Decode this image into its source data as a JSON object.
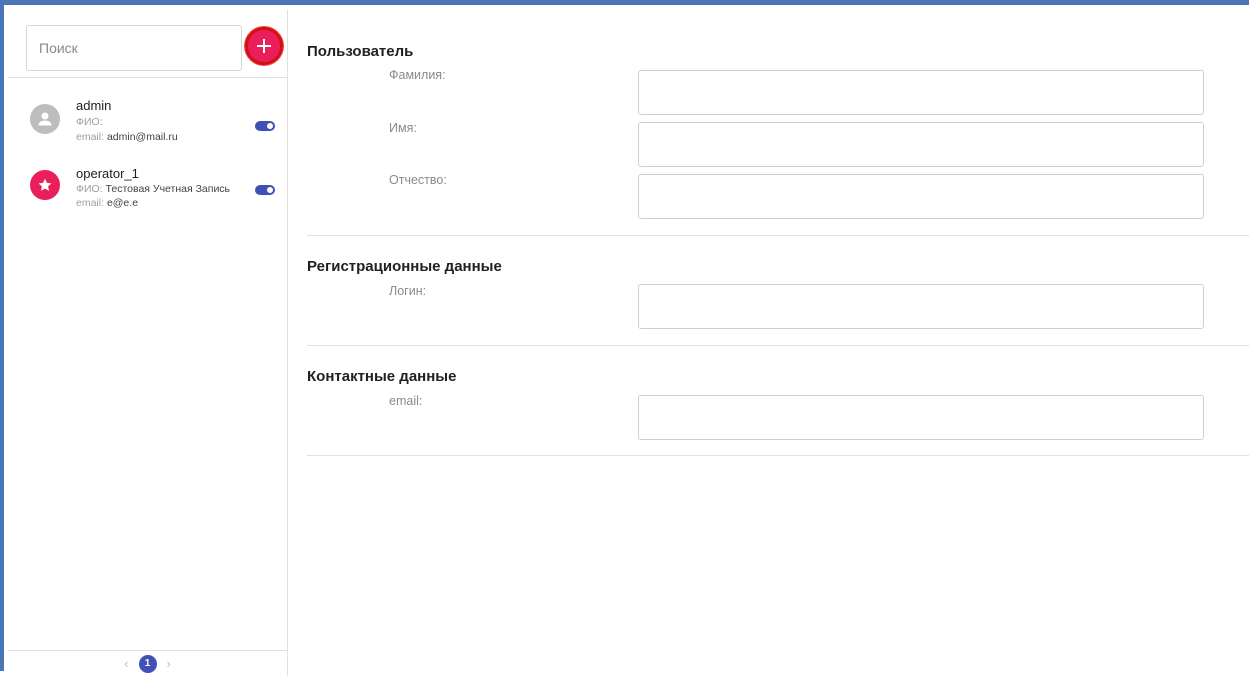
{
  "colors": {
    "frame_border": "#4a76b8",
    "accent_pink": "#e91e5a",
    "highlight_red": "#d41016",
    "toggle_blue": "#3f51b5",
    "avatar_grey": "#bdbdbd"
  },
  "sidebar": {
    "search": {
      "placeholder": "Поиск",
      "value": ""
    },
    "add_button": {
      "icon": "plus-icon"
    },
    "users": [
      {
        "name": "admin",
        "fio_label": "ФИО:",
        "fio_value": "",
        "email_label": "email:",
        "email_value": "admin@mail.ru",
        "avatar_icon": "person-icon",
        "enabled": true
      },
      {
        "name": "operator_1",
        "fio_label": "ФИО:",
        "fio_value": "Тестовая Учетная Запись",
        "email_label": "email:",
        "email_value": "e@e.e",
        "avatar_icon": "star-icon",
        "enabled": true
      }
    ],
    "pagination": {
      "prev": "‹",
      "current": "1",
      "next": "›"
    }
  },
  "form": {
    "user_section": {
      "title": "Пользователь",
      "last_name_label": "Фамилия:",
      "first_name_label": "Имя:",
      "patronymic_label": "Отчество:"
    },
    "registration_section": {
      "title": "Регистрационные данные",
      "login_label": "Логин:"
    },
    "contact_section": {
      "title": "Контактные данные",
      "email_label": "email:"
    }
  }
}
